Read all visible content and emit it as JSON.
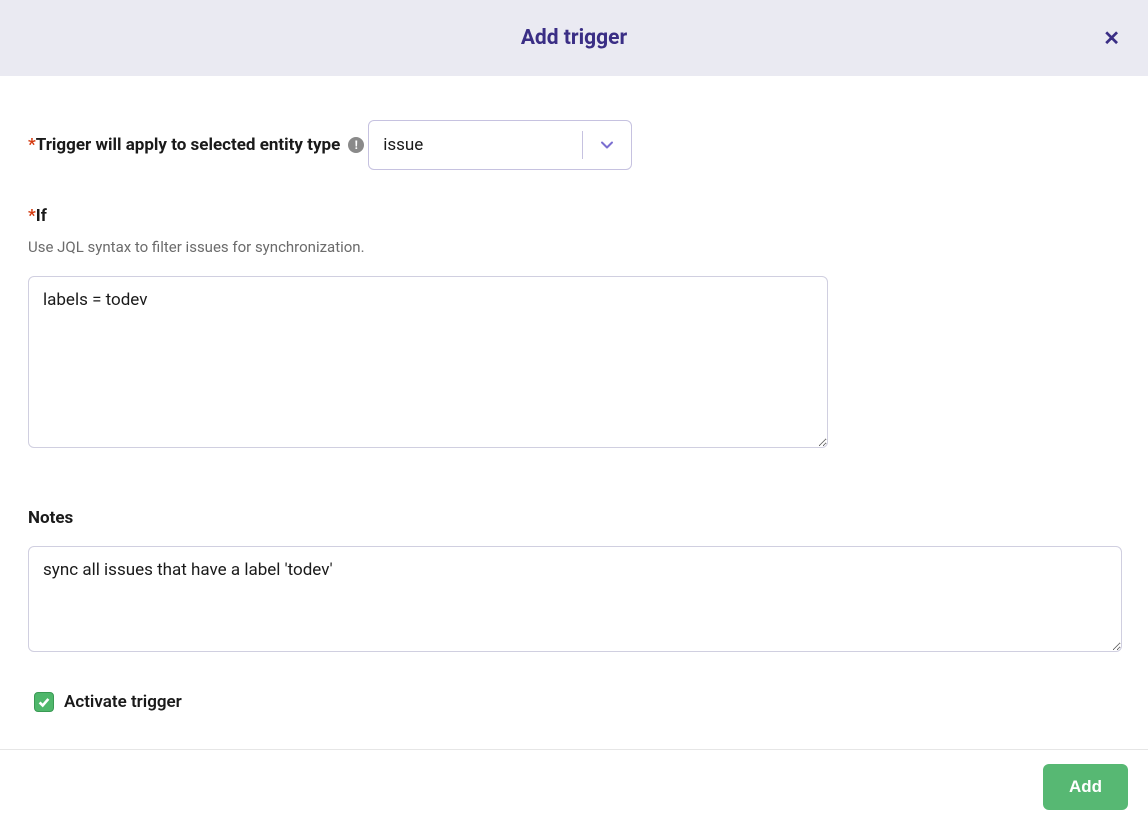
{
  "header": {
    "title": "Add trigger"
  },
  "entityType": {
    "label": "Trigger will apply to selected entity type",
    "selectedValue": "issue"
  },
  "ifField": {
    "label": "If",
    "helper": "Use JQL syntax to filter issues for synchronization.",
    "value": "labels = todev"
  },
  "notesField": {
    "label": "Notes",
    "value": "sync all issues that have a label 'todev'"
  },
  "activate": {
    "label": "Activate trigger",
    "checked": true
  },
  "footer": {
    "addLabel": "Add"
  }
}
